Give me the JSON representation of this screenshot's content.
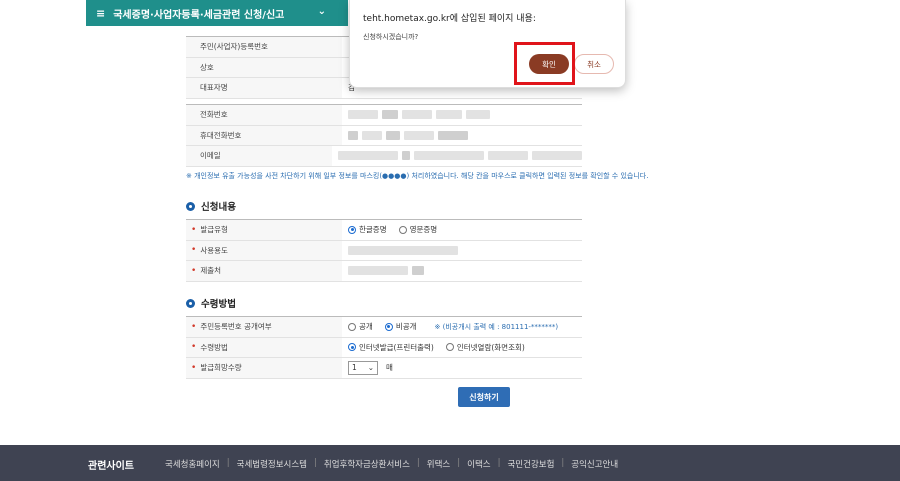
{
  "topnav": {
    "menu_icon": "≡",
    "title": "국세증명·사업자등록·세금관련 신청/신고",
    "chevron": "⌄"
  },
  "info": {
    "rows": [
      {
        "label": "주민(사업자)등록번호"
      },
      {
        "label": "상호"
      },
      {
        "label": "대표자명",
        "value": "김"
      }
    ]
  },
  "contact": {
    "rows": [
      {
        "label": "전화번호"
      },
      {
        "label": "휴대전화번호"
      },
      {
        "label": "이메일"
      }
    ]
  },
  "notice": "※ 개인정보 유출 가능성을 사전 차단하기 위해 일부 정보를 마스킹(●●●●) 처리하였습니다. 해당 칸을 마우스로 클릭하면 입력된 정보를 확인할 수 있습니다.",
  "section_apply": {
    "title": "신청내용",
    "issue_type": {
      "label": "발급유형",
      "options": [
        "한글증명",
        "영문증명"
      ],
      "selected": "한글증명"
    },
    "purpose": {
      "label": "사용용도"
    },
    "submit_to": {
      "label": "제출처"
    }
  },
  "section_receive": {
    "title": "수령방법",
    "rrn_disclose": {
      "label": "주민등록번호 공개여부",
      "options": [
        "공개",
        "비공개"
      ],
      "selected": "비공개",
      "hint": "※ (비공개시 출력 예 : 801111-*******)"
    },
    "method": {
      "label": "수령방법",
      "options": [
        "인터넷발급(프린터출력)",
        "인터넷열람(화면조회)"
      ],
      "selected": "인터넷발급(프린터출력)"
    },
    "count": {
      "label": "발급희망수량",
      "value": "1",
      "unit": "매"
    }
  },
  "apply_button": "신청하기",
  "footer": {
    "title": "관련사이트",
    "links": [
      "국세청홈페이지",
      "국세법령정보시스템",
      "취업후학자금상환서비스",
      "위택스",
      "이택스",
      "국민건강보험",
      "공익신고안내"
    ]
  },
  "dialog": {
    "title": "teht.hometax.go.kr에 삽입된 페이지 내용:",
    "message": "신청하시겠습니까?",
    "ok": "확인",
    "cancel": "취소"
  },
  "colors": {
    "nav": "#1f8f8b",
    "primary_button": "#2f6db5",
    "dialog_ok": "#8a3b24",
    "highlight": "#e0141a",
    "footer": "#3f4352"
  }
}
